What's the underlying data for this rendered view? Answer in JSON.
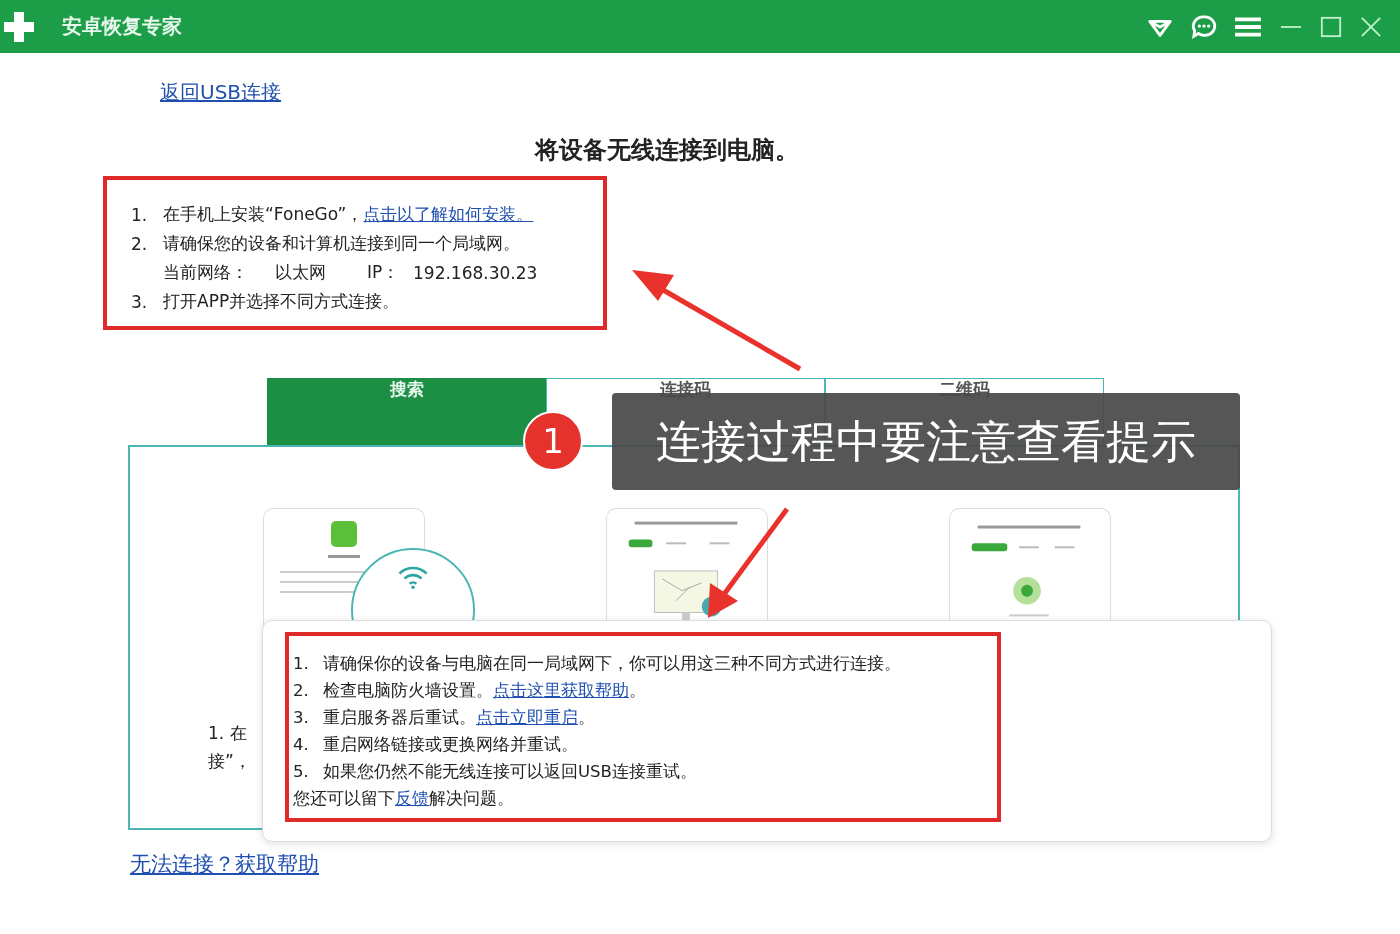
{
  "window": {
    "title": "安卓恢复专家"
  },
  "back_link": "返回USB连接",
  "heading": "将设备无线连接到电脑。",
  "steps": [
    {
      "number": "1.",
      "text": "在手机上安装“FoneGo”，",
      "link": "点击以了解如何安装。"
    },
    {
      "number": "2.",
      "text": "请确保您的设备和计算机连接到同一个局域网。",
      "network": {
        "label": "当前网络：",
        "value": "以太网",
        "ip_label": "IP：",
        "ip": "192.168.30.23"
      }
    },
    {
      "number": "3.",
      "text": "打开APP并选择不同方式连接。"
    }
  ],
  "tabs": [
    {
      "label": "搜索",
      "selected": true
    },
    {
      "label": "连接码",
      "selected": false
    },
    {
      "label": "二维码",
      "selected": false
    }
  ],
  "hidden_text": [
    "1. 在",
    "接”，"
  ],
  "popup": {
    "tips": [
      {
        "number": "1.",
        "text": "请确保你的设备与电脑在同一局域网下，你可以用这三种不同方式进行连接。"
      },
      {
        "number": "2.",
        "text": "检查电脑防火墙设置。",
        "link": "点击这里获取帮助",
        "after": "。"
      },
      {
        "number": "3.",
        "text": "重启服务器后重试。",
        "link": "点击立即重启",
        "after": "。"
      },
      {
        "number": "4.",
        "text": "重启网络链接或更换网络并重试。"
      },
      {
        "number": "5.",
        "text": "如果您仍然不能无线连接可以返回USB连接重试。"
      }
    ],
    "feedback": {
      "before": "您还可以留下",
      "link": "反馈",
      "after": "解决问题。"
    }
  },
  "help_link": "无法连接？获取帮助",
  "callout": {
    "number": "1",
    "text": "连接过程中要注意查看提示"
  }
}
